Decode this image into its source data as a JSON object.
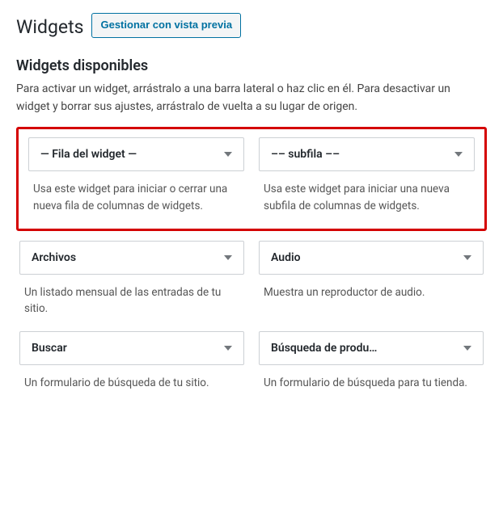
{
  "header": {
    "title": "Widgets",
    "manage_button": "Gestionar con vista previa"
  },
  "available": {
    "title": "Widgets disponibles",
    "description": "Para activar un widget, arrástralo a una barra lateral o haz clic en él. Para desactivar un widget y borrar sus ajustes, arrástralo de vuelta a su lugar de origen."
  },
  "highlighted": [
    {
      "title": "— Fila del widget —",
      "desc": "Usa este widget para iniciar o cerrar una nueva fila de colum­nas de widgets."
    },
    {
      "title": "–– subfila ––",
      "desc": "Usa este widget para iniciar una nueva subfila de columnas de widgets."
    }
  ],
  "widgets": [
    {
      "title": "Archivos",
      "desc": "Un listado mensual de las en­tradas de tu sitio."
    },
    {
      "title": "Audio",
      "desc": "Muestra un reproductor de au­dio."
    },
    {
      "title": "Buscar",
      "desc": "Un formulario de búsqueda de tu sitio."
    },
    {
      "title": "Búsqueda de produ…",
      "desc": "Un formulario de búsqueda pa­ra tu tienda."
    }
  ]
}
